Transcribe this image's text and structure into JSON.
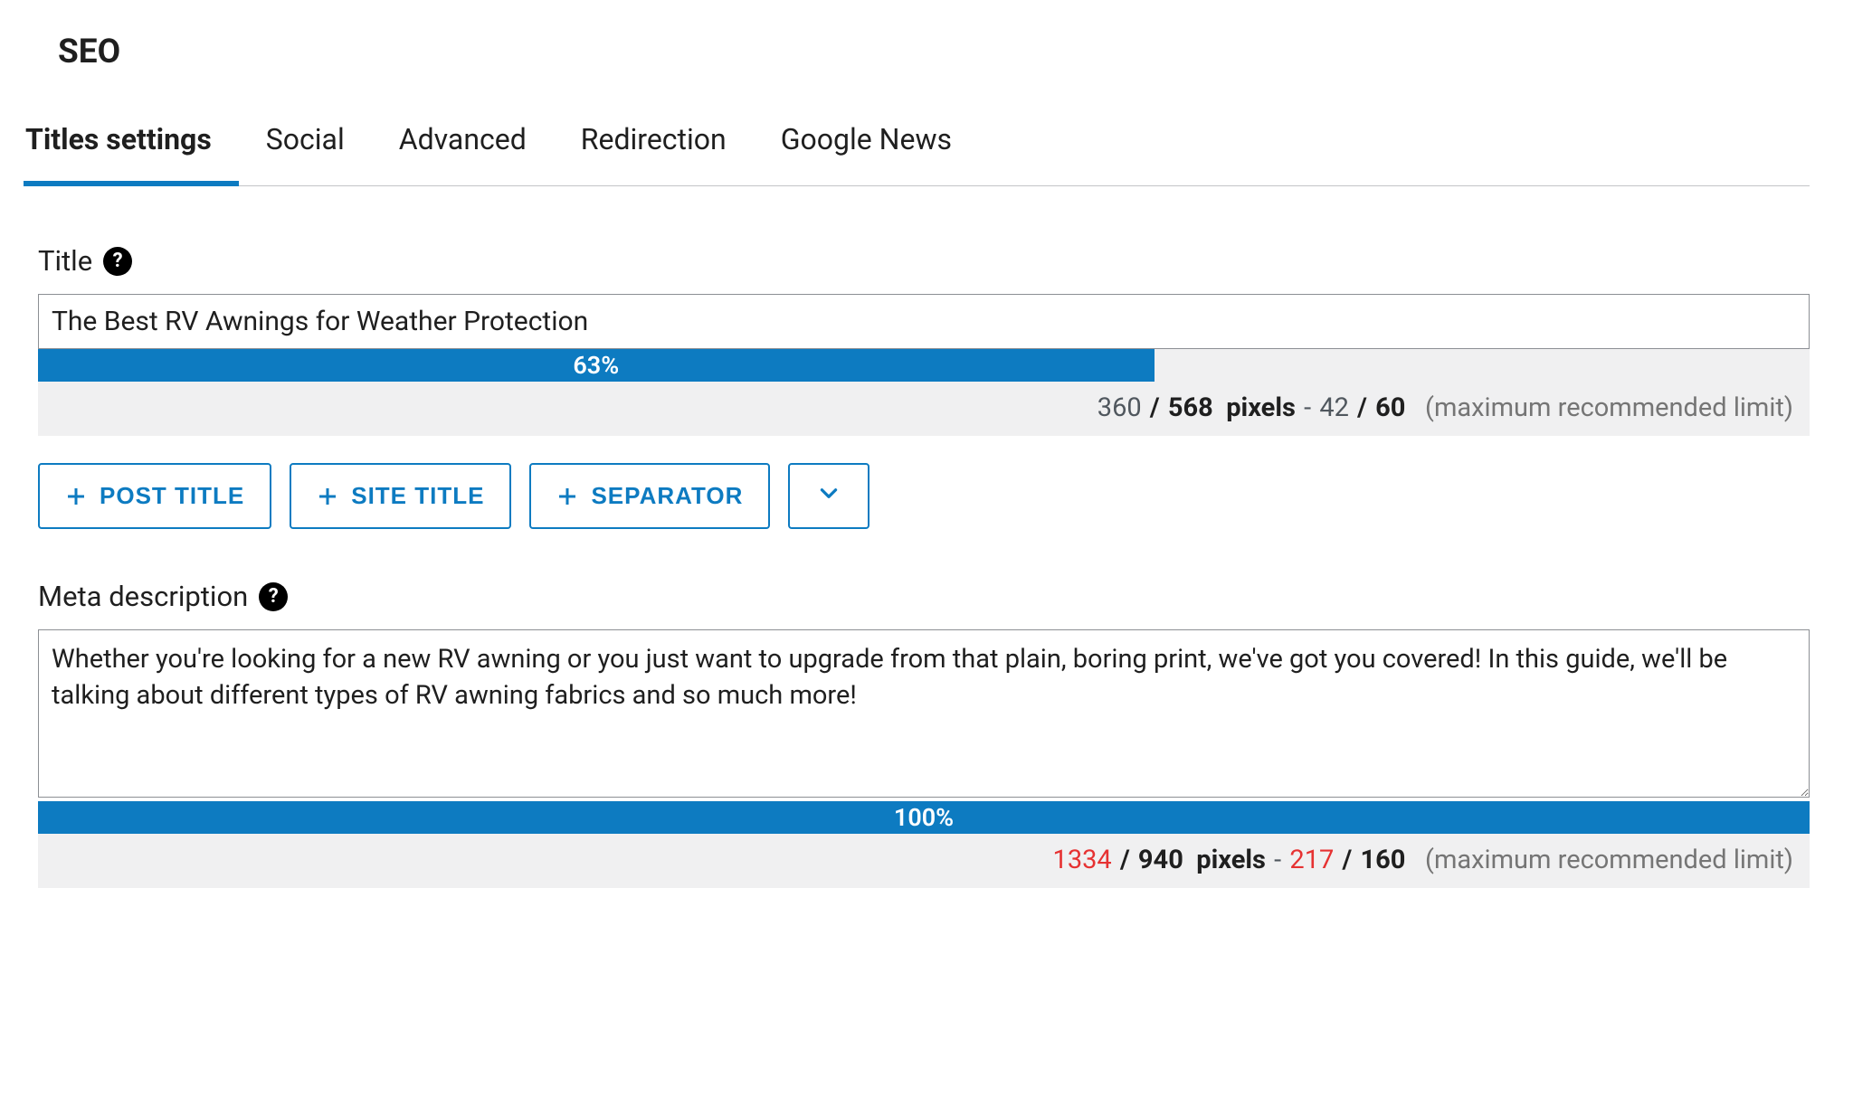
{
  "page": {
    "title": "SEO"
  },
  "tabs": {
    "items": [
      {
        "label": "Titles settings",
        "active": true
      },
      {
        "label": "Social",
        "active": false
      },
      {
        "label": "Advanced",
        "active": false
      },
      {
        "label": "Redirection",
        "active": false
      },
      {
        "label": "Google News",
        "active": false
      }
    ]
  },
  "title_field": {
    "label": "Title",
    "value": "The Best RV Awnings for Weather Protection",
    "progress_percent": "63%",
    "progress_width": 63,
    "pixels_current": "360",
    "pixels_max": "568",
    "chars_current": "42",
    "chars_max": "60",
    "limit_text": "(maximum recommended limit)",
    "pixels_word": "pixels",
    "over_limit": false
  },
  "tag_buttons": {
    "post_title": "POST TITLE",
    "site_title": "SITE TITLE",
    "separator": "SEPARATOR"
  },
  "meta_field": {
    "label": "Meta description",
    "value": "Whether you're looking for a new RV awning or you just want to upgrade from that plain, boring print, we've got you covered! In this guide, we'll be talking about different types of RV awning fabrics and so much more!",
    "progress_percent": "100%",
    "progress_width": 100,
    "pixels_current": "1334",
    "pixels_max": "940",
    "chars_current": "217",
    "chars_max": "160",
    "limit_text": "(maximum recommended limit)",
    "pixels_word": "pixels",
    "over_limit": true
  }
}
